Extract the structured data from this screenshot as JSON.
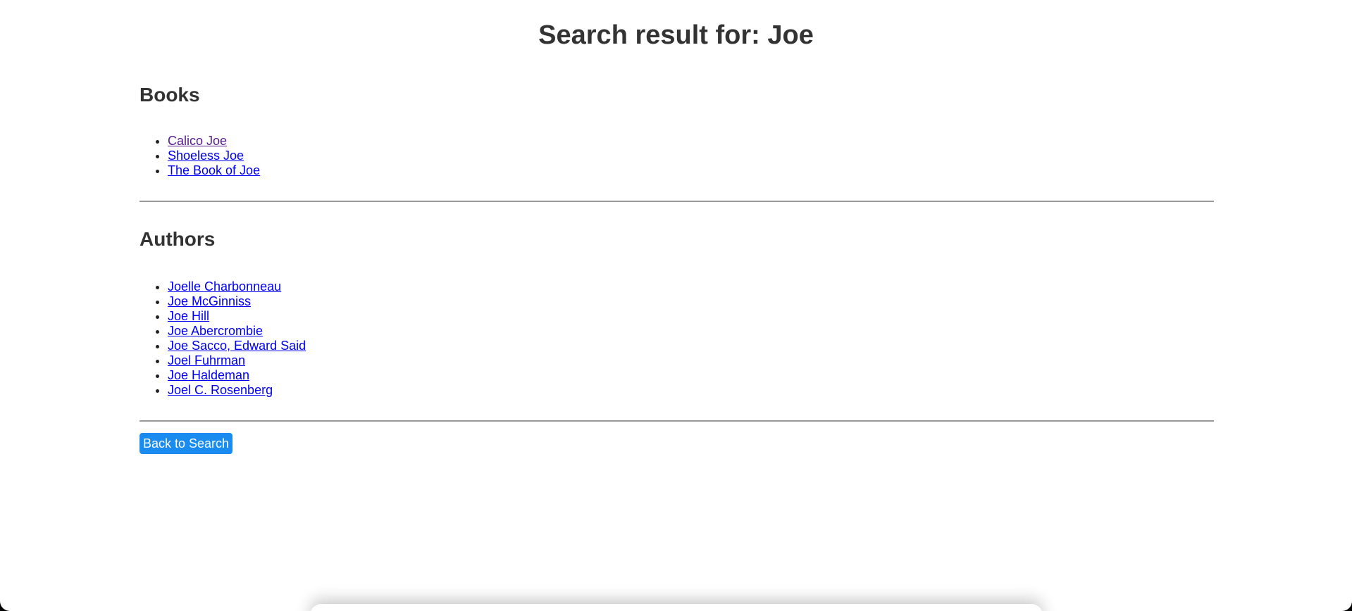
{
  "page": {
    "title": "Search result for: Joe"
  },
  "books": {
    "heading": "Books",
    "items": [
      {
        "label": "Calico Joe",
        "visited": true
      },
      {
        "label": "Shoeless Joe",
        "visited": false
      },
      {
        "label": "The Book of Joe",
        "visited": false
      }
    ]
  },
  "authors": {
    "heading": "Authors",
    "items": [
      {
        "label": "Joelle Charbonneau"
      },
      {
        "label": "Joe McGinniss"
      },
      {
        "label": "Joe Hill"
      },
      {
        "label": "Joe Abercrombie"
      },
      {
        "label": "Joe Sacco, Edward Said"
      },
      {
        "label": "Joel Fuhrman"
      },
      {
        "label": "Joe Haldeman"
      },
      {
        "label": "Joel C. Rosenberg"
      }
    ]
  },
  "actions": {
    "back_label": "Back to Search"
  },
  "colors": {
    "link": "#0000ee",
    "visited_link": "#551a8b",
    "button_bg": "#1a8cf0",
    "heading_text": "#333333"
  }
}
